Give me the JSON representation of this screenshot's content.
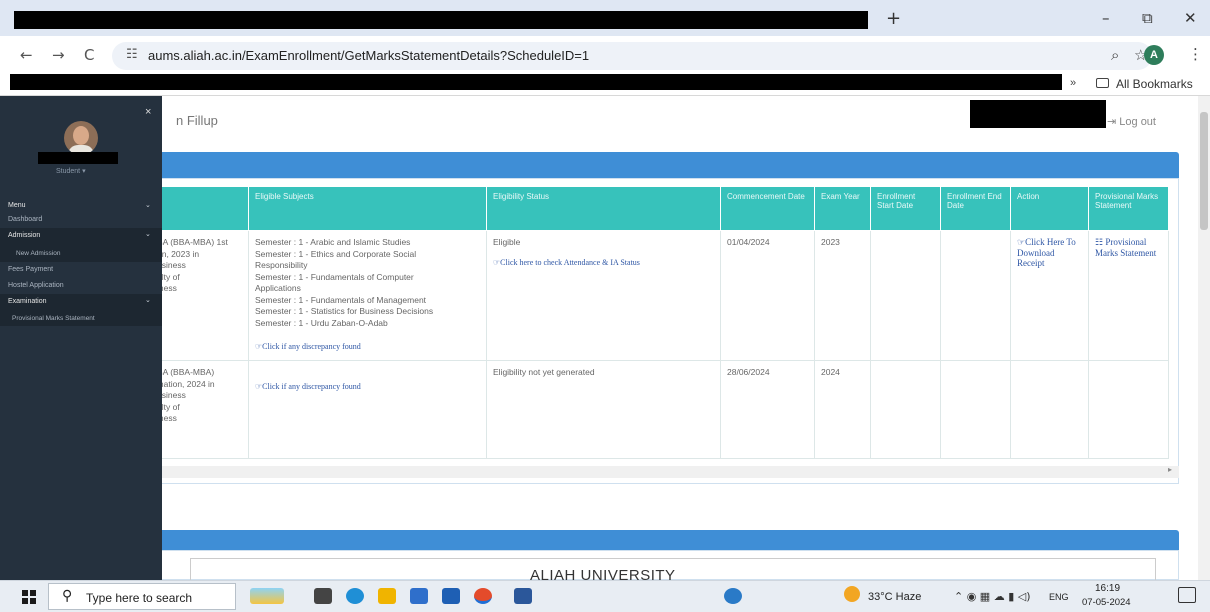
{
  "browser": {
    "new_tab": "+",
    "window_controls": {
      "minimize": "–",
      "restore": "⧉",
      "close": "✕"
    },
    "nav": {
      "back": "←",
      "forward": "→",
      "reload": "C"
    },
    "url": "aums.aliah.ac.in/ExamEnrollment/GetMarksStatementDetails?ScheduleID=1",
    "profile_initial": "A",
    "more_bookmarks": "»",
    "all_bookmarks": "All Bookmarks"
  },
  "page": {
    "title_fragment": "n Fillup",
    "logout": "Log out"
  },
  "sidebar": {
    "close": "×",
    "role": "Student ▾",
    "menu_label": "Menu",
    "items": [
      {
        "label": "Dashboard"
      },
      {
        "label": "Admission"
      },
      {
        "label": "New Admission"
      },
      {
        "label": "Fees Payment"
      },
      {
        "label": "Hostel Application"
      },
      {
        "label": "Examination"
      },
      {
        "label": "Provisional Marks Statement"
      }
    ]
  },
  "table": {
    "headers": [
      "",
      "Eligible Subjects",
      "Eligibility Status",
      "Commencement Date",
      "Exam Year",
      "Enrollment Start Date",
      "Enrollment End Date",
      "Action",
      "Provisional Marks Statement"
    ],
    "rows": [
      {
        "course": [
          "BA (BBA-MBA) 1st",
          "on, 2023 in",
          "usiness",
          "ulty of",
          "iness"
        ],
        "subjects": [
          "Semester : 1 - Arabic and Islamic Studies",
          "Semester : 1 - Ethics and Corporate Social",
          "Responsibility",
          "Semester : 1 - Fundamentals of Computer",
          "Applications",
          "Semester : 1 - Fundamentals of Management",
          "Semester : 1 - Statistics for Business Decisions",
          "Semester : 1 - Urdu Zaban-O-Adab"
        ],
        "discrepancy_link": "☞Click if any discrepancy found",
        "status": "Eligible",
        "status_link": "☞Click here to check Attendance & IA Status",
        "commencement": "01/04/2024",
        "exam_year": "2023",
        "enroll_start": "",
        "enroll_end": "",
        "action": "☞Click Here To Download Receipt",
        "provisional": "☷ Provisional Marks Statement"
      },
      {
        "course": [
          "BA (BBA-MBA)",
          "ination, 2024 in",
          "usiness",
          "ulty of",
          "iness"
        ],
        "subjects": [],
        "discrepancy_link": "☞Click if any discrepancy found",
        "status": "Eligibility not yet generated",
        "status_link": "",
        "commencement": "28/06/2024",
        "exam_year": "2024",
        "enroll_start": "",
        "enroll_end": "",
        "action": "",
        "provisional": ""
      }
    ]
  },
  "section2": {
    "university": "ALIAH UNIVERSITY"
  },
  "taskbar": {
    "search_placeholder": "Type here to search",
    "weather": "33°C  Haze",
    "language": "ENG",
    "time": "16:19",
    "date": "07-05-2024"
  },
  "colors": {
    "table_header": "#37c2bb",
    "panel_header": "#3f8ed6",
    "sidebar": "#25313e"
  }
}
